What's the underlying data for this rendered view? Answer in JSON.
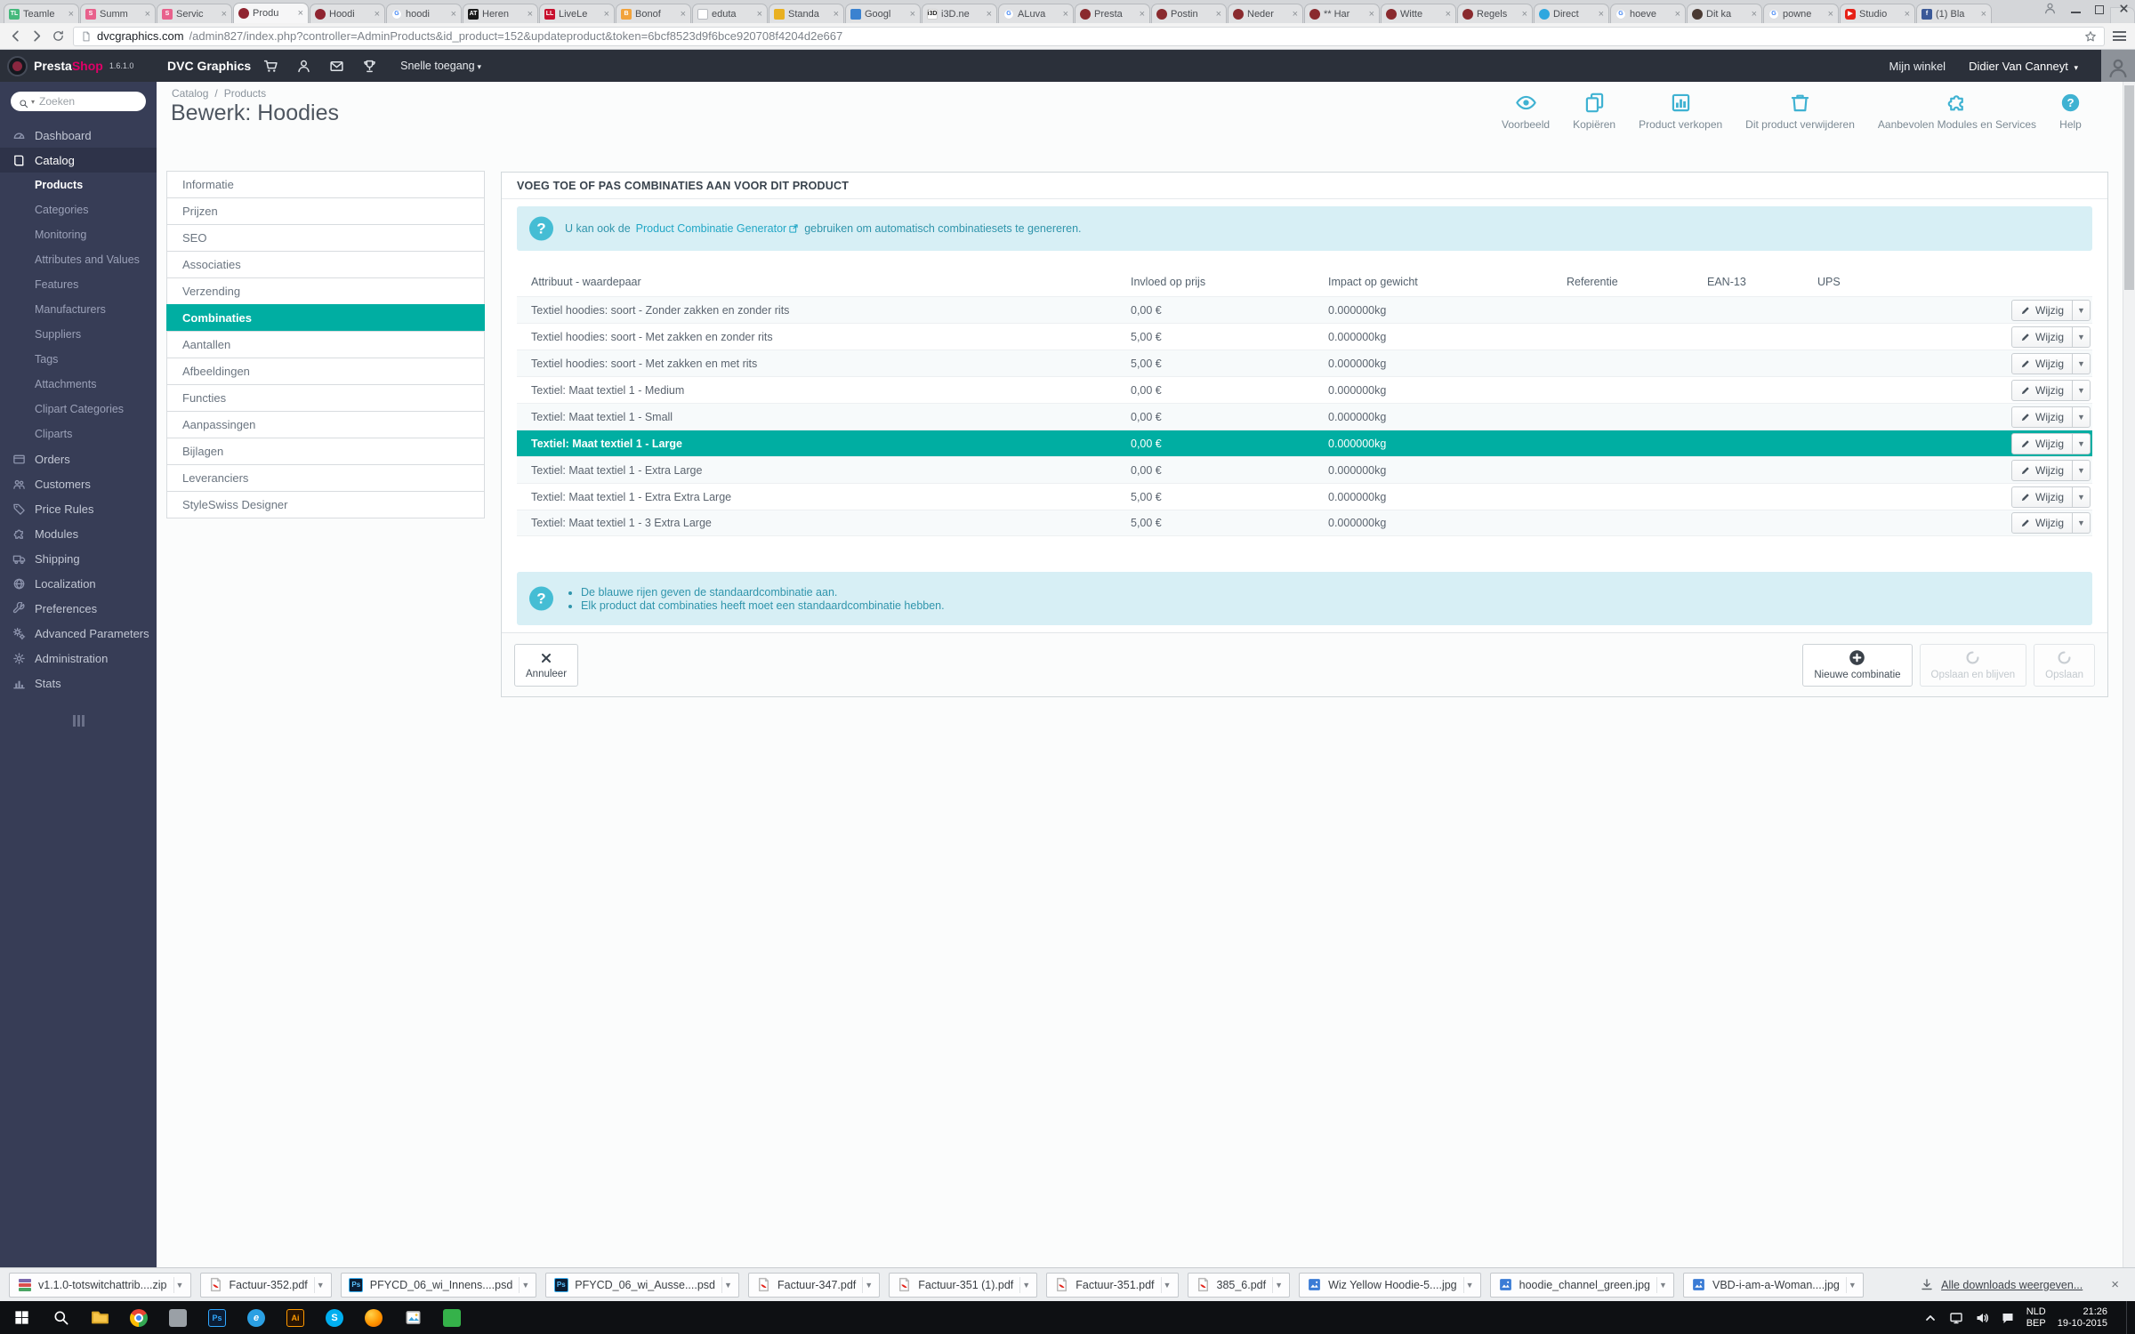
{
  "browser": {
    "tabs": [
      {
        "label": "Teamle",
        "fav": {
          "glyph": "TL",
          "bg": "#45b97c",
          "fg": "#ffffff",
          "shape": "square"
        }
      },
      {
        "label": "Summ",
        "fav": {
          "glyph": "S",
          "bg": "#e8618c",
          "fg": "#ffffff",
          "shape": "square"
        }
      },
      {
        "label": "Servic",
        "fav": {
          "glyph": "S",
          "bg": "#e8618c",
          "fg": "#ffffff",
          "shape": "square"
        }
      },
      {
        "label": "Produ",
        "active": true,
        "fav": {
          "glyph": "",
          "bg": "#8f2430",
          "fg": "#ffffff",
          "shape": "circle"
        }
      },
      {
        "label": "Hoodi",
        "fav": {
          "glyph": "",
          "bg": "#8f2430",
          "fg": "#ffffff",
          "shape": "circle"
        }
      },
      {
        "label": "hoodi",
        "fav": {
          "glyph": "G",
          "bg": "#ffffff",
          "fg": "#4285f4",
          "shape": "circle",
          "border": "#dadce0"
        }
      },
      {
        "label": "Heren",
        "fav": {
          "glyph": "AT",
          "bg": "#1a1a1a",
          "fg": "#ffffff",
          "shape": "square"
        }
      },
      {
        "label": "LiveLe",
        "fav": {
          "glyph": "LL",
          "bg": "#c8102e",
          "fg": "#ffffff",
          "shape": "square"
        }
      },
      {
        "label": "Bonof",
        "fav": {
          "glyph": "B",
          "bg": "#f2a33c",
          "fg": "#ffffff",
          "shape": "square"
        }
      },
      {
        "label": "eduta",
        "fav": {
          "glyph": "",
          "bg": "#ffffff",
          "fg": "#9aa0a6",
          "shape": "square",
          "border": "#b6b9be"
        }
      },
      {
        "label": "Standa",
        "fav": {
          "glyph": "",
          "bg": "#e9b021",
          "fg": "#7a5200",
          "shape": "grid"
        }
      },
      {
        "label": "Googl",
        "fav": {
          "glyph": "",
          "bg": "#3b82d0",
          "fg": "#ffffff",
          "shape": "square"
        }
      },
      {
        "label": "i3D.ne",
        "fav": {
          "glyph": "i3D",
          "bg": "#ffffff",
          "fg": "#222222",
          "shape": "square",
          "border": "#cfcfcf"
        }
      },
      {
        "label": "ALuva",
        "fav": {
          "glyph": "G",
          "bg": "#ffffff",
          "fg": "#4285f4",
          "shape": "circle",
          "border": "#dadce0"
        }
      },
      {
        "label": "Presta",
        "fav": {
          "glyph": "",
          "bg": "#8a2a2e",
          "fg": "#f2c9a0",
          "shape": "circle"
        }
      },
      {
        "label": "Postin",
        "fav": {
          "glyph": "",
          "bg": "#8a2a2e",
          "fg": "#f2c9a0",
          "shape": "circle"
        }
      },
      {
        "label": "Neder",
        "fav": {
          "glyph": "",
          "bg": "#8a2a2e",
          "fg": "#f2c9a0",
          "shape": "circle"
        }
      },
      {
        "label": "** Har",
        "fav": {
          "glyph": "",
          "bg": "#8a2a2e",
          "fg": "#f2c9a0",
          "shape": "circle"
        }
      },
      {
        "label": "Witte",
        "fav": {
          "glyph": "",
          "bg": "#8a2a2e",
          "fg": "#f2c9a0",
          "shape": "circle"
        }
      },
      {
        "label": "Regels",
        "fav": {
          "glyph": "",
          "bg": "#8a2a2e",
          "fg": "#f2c9a0",
          "shape": "circle"
        }
      },
      {
        "label": "Direct",
        "fav": {
          "glyph": "",
          "bg": "#2fa7df",
          "fg": "#ffffff",
          "shape": "circle"
        }
      },
      {
        "label": "hoeve",
        "fav": {
          "glyph": "G",
          "bg": "#ffffff",
          "fg": "#4285f4",
          "shape": "circle",
          "border": "#dadce0"
        }
      },
      {
        "label": "Dit ka",
        "fav": {
          "glyph": "",
          "bg": "#4a3a33",
          "fg": "#d9b38c",
          "shape": "circle"
        }
      },
      {
        "label": "powne",
        "fav": {
          "glyph": "G",
          "bg": "#ffffff",
          "fg": "#4285f4",
          "shape": "circle",
          "border": "#dadce0"
        }
      },
      {
        "label": "Studio",
        "fav": {
          "glyph": "▶",
          "bg": "#e62117",
          "fg": "#ffffff",
          "shape": "rounded"
        }
      },
      {
        "label": "(1) Bla",
        "fav": {
          "glyph": "f",
          "bg": "#3b5998",
          "fg": "#ffffff",
          "shape": "square"
        }
      }
    ],
    "url": {
      "domain": "dvcgraphics.com",
      "path": "/admin827/index.php?controller=AdminProducts&id_product=152&updateproduct&token=6bcf8523d9f6bce920708f4204d2e667"
    }
  },
  "admin_header": {
    "brand": {
      "presta": "Presta",
      "shop": "Shop",
      "version": "1.6.1.0"
    },
    "shop_name": "DVC Graphics",
    "quick_access_label": "Snelle toegang",
    "my_shop_label": "Mijn winkel",
    "user_name": "Didier Van Canneyt"
  },
  "sidebar": {
    "search_placeholder": "Zoeken",
    "items": [
      {
        "label": "Dashboard",
        "icon": "gauge",
        "type": "root"
      },
      {
        "label": "Catalog",
        "icon": "book",
        "type": "root",
        "active": true
      },
      {
        "label": "Products",
        "type": "sub",
        "active": true
      },
      {
        "label": "Categories",
        "type": "sub"
      },
      {
        "label": "Monitoring",
        "type": "sub"
      },
      {
        "label": "Attributes and Values",
        "type": "sub"
      },
      {
        "label": "Features",
        "type": "sub"
      },
      {
        "label": "Manufacturers",
        "type": "sub"
      },
      {
        "label": "Suppliers",
        "type": "sub"
      },
      {
        "label": "Tags",
        "type": "sub"
      },
      {
        "label": "Attachments",
        "type": "sub"
      },
      {
        "label": "Clipart Categories",
        "type": "sub"
      },
      {
        "label": "Cliparts",
        "type": "sub"
      },
      {
        "label": "Orders",
        "icon": "card",
        "type": "root"
      },
      {
        "label": "Customers",
        "icon": "users",
        "type": "root"
      },
      {
        "label": "Price Rules",
        "icon": "tag",
        "type": "root"
      },
      {
        "label": "Modules",
        "icon": "puzzle",
        "type": "root"
      },
      {
        "label": "Shipping",
        "icon": "truck",
        "type": "root"
      },
      {
        "label": "Localization",
        "icon": "globe",
        "type": "root"
      },
      {
        "label": "Preferences",
        "icon": "wrench",
        "type": "root"
      },
      {
        "label": "Advanced Parameters",
        "icon": "cogs",
        "type": "root"
      },
      {
        "label": "Administration",
        "icon": "gear",
        "type": "root"
      },
      {
        "label": "Stats",
        "icon": "chart",
        "type": "root"
      }
    ]
  },
  "page": {
    "breadcrumb": {
      "part1": "Catalog",
      "sep": "/",
      "part2": "Products"
    },
    "title": "Bewerk: Hoodies",
    "toolbar": [
      {
        "label": "Voorbeeld",
        "icon": "eye"
      },
      {
        "label": "Kopiëren",
        "icon": "copy"
      },
      {
        "label": "Product verkopen",
        "icon": "chartbox"
      },
      {
        "label": "Dit product verwijderen",
        "icon": "trash"
      },
      {
        "label": "Aanbevolen Modules en Services",
        "icon": "puzzle"
      },
      {
        "label": "Help",
        "icon": "help"
      }
    ]
  },
  "product_tabs": {
    "active": "Combinaties",
    "items": [
      "Informatie",
      "Prijzen",
      "SEO",
      "Associaties",
      "Verzending",
      "Combinaties",
      "Aantallen",
      "Afbeeldingen",
      "Functies",
      "Aanpassingen",
      "Bijlagen",
      "Leveranciers",
      "StyleSwiss Designer"
    ]
  },
  "panel": {
    "heading": "VOEG TOE OF PAS COMBINATIES AAN VOOR DIT PRODUCT",
    "generator_hint": {
      "before": "U kan ook de",
      "link": "Product Combinatie Generator",
      "after": "gebruiken om automatisch combinatiesets te genereren."
    },
    "table": {
      "columns": [
        "Attribuut - waardepaar",
        "Invloed op prijs",
        "Impact op gewicht",
        "Referentie",
        "EAN-13",
        "UPS"
      ],
      "edit_label": "Wijzig",
      "rows": [
        {
          "attribute": "Textiel hoodies: soort - Zonder zakken en zonder rits",
          "price": "0,00 €",
          "weight": "0.000000kg",
          "reference": "",
          "ean13": "",
          "ups": ""
        },
        {
          "attribute": "Textiel hoodies: soort - Met zakken en zonder rits",
          "price": "5,00 €",
          "weight": "0.000000kg",
          "reference": "",
          "ean13": "",
          "ups": ""
        },
        {
          "attribute": "Textiel hoodies: soort - Met zakken en met rits",
          "price": "5,00 €",
          "weight": "0.000000kg",
          "reference": "",
          "ean13": "",
          "ups": ""
        },
        {
          "attribute": "Textiel: Maat textiel 1 - Medium",
          "price": "0,00 €",
          "weight": "0.000000kg",
          "reference": "",
          "ean13": "",
          "ups": ""
        },
        {
          "attribute": "Textiel: Maat textiel 1 - Small",
          "price": "0,00 €",
          "weight": "0.000000kg",
          "reference": "",
          "ean13": "",
          "ups": ""
        },
        {
          "attribute": "Textiel: Maat textiel 1 - Large",
          "price": "0,00 €",
          "weight": "0.000000kg",
          "reference": "",
          "ean13": "",
          "ups": "",
          "highlighted": true
        },
        {
          "attribute": "Textiel: Maat textiel 1 - Extra Large",
          "price": "0,00 €",
          "weight": "0.000000kg",
          "reference": "",
          "ean13": "",
          "ups": ""
        },
        {
          "attribute": "Textiel: Maat textiel 1 - Extra Extra Large",
          "price": "5,00 €",
          "weight": "0.000000kg",
          "reference": "",
          "ean13": "",
          "ups": ""
        },
        {
          "attribute": "Textiel: Maat textiel 1 - 3 Extra Large",
          "price": "5,00 €",
          "weight": "0.000000kg",
          "reference": "",
          "ean13": "",
          "ups": ""
        }
      ]
    },
    "notes": [
      "De blauwe rijen geven de standaardcombinatie aan.",
      "Elk product dat combinaties heeft moet een standaardcombinatie hebben."
    ],
    "footer": {
      "cancel_label": "Annuleer",
      "new_combination_label": "Nieuwe combinatie",
      "save_stay_label": "Opslaan en blijven",
      "save_label": "Opslaan"
    }
  },
  "downloads_bar": {
    "items": [
      {
        "name": "v1.1.0-totswitchattrib....zip",
        "type": "zip"
      },
      {
        "name": "Factuur-352.pdf",
        "type": "pdf"
      },
      {
        "name": "PFYCD_06_wi_Innens....psd",
        "type": "psd"
      },
      {
        "name": "PFYCD_06_wi_Ausse....psd",
        "type": "psd"
      },
      {
        "name": "Factuur-347.pdf",
        "type": "pdf"
      },
      {
        "name": "Factuur-351 (1).pdf",
        "type": "pdf"
      },
      {
        "name": "Factuur-351.pdf",
        "type": "pdf"
      },
      {
        "name": "385_6.pdf",
        "type": "pdf"
      },
      {
        "name": "Wiz Yellow Hoodie-5....jpg",
        "type": "img"
      },
      {
        "name": "hoodie_channel_green.jpg",
        "type": "img"
      },
      {
        "name": "VBD-i-am-a-Woman....jpg",
        "type": "img"
      }
    ],
    "show_all_label": "Alle downloads weergeven..."
  },
  "taskbar": {
    "apps": [
      "start",
      "search",
      "file-explorer",
      "chrome",
      "app-gray",
      "photoshop",
      "edge",
      "illustrator",
      "skype",
      "firefox",
      "photos",
      "app-green"
    ],
    "tray": {
      "lang_top": "NLD",
      "lang_bottom": "BEP",
      "time": "21:26",
      "date": "19-10-2015"
    }
  },
  "colors": {
    "accent_teal": "#00aea2",
    "toolbar_icon": "#3fb2d2",
    "presta_pink": "#df0067",
    "alert_bg": "#d7eff5",
    "alert_text": "#3095ac",
    "sidebar_bg": "#373d56",
    "header_bg": "#2b303a",
    "taskbar_bg": "#0e1013"
  }
}
